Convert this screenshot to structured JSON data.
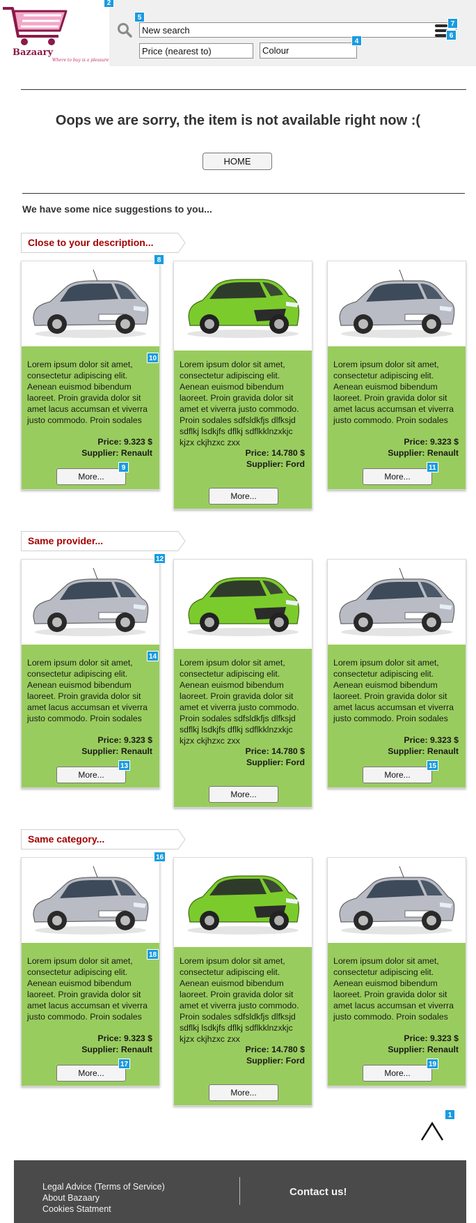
{
  "logo": {
    "name": "Bazaary",
    "tagline": "Where to buy is a pleasure"
  },
  "search": {
    "value": "New search",
    "price_value": "Price (nearest to)",
    "colour_value": "Colour"
  },
  "main": {
    "sorry": "Oops we are sorry, the item is not available right now :(",
    "home_label": "HOME",
    "suggestions": "We have some nice suggestions to you..."
  },
  "sections": [
    {
      "title": "Close to your description...",
      "cards": [
        {
          "car": "silver-hatchback",
          "desc": "Lorem ipsum dolor sit amet, consectetur adipiscing elit. Aenean euismod bibendum laoreet. Proin gravida dolor sit amet lacus accumsan et viverra justo commodo. Proin sodales",
          "price": "Price: 9.323 $",
          "supplier": "Supplier: Renault",
          "more": "More..."
        },
        {
          "car": "green-hatchback",
          "desc": "Lorem ipsum dolor sit amet, consectetur adipiscing elit. Aenean euismod bibendum laoreet. Proin gravida dolor sit amet et viverra justo commodo. Proin sodales sdfsldkfjs dlfksjd sdflkj lsdkjfs dflkj sdflkklnzxkjc kjzx ckjhzxc zxx",
          "price": "Price: 14.780 $",
          "supplier": "Supplier: Ford",
          "more": "More..."
        },
        {
          "car": "silver-hatchback",
          "desc": "Lorem ipsum dolor sit amet, consectetur adipiscing elit. Aenean euismod bibendum laoreet. Proin gravida dolor sit amet lacus accumsan et viverra justo commodo. Proin sodales",
          "price": "Price: 9.323 $",
          "supplier": "Supplier: Renault",
          "more": "More..."
        }
      ]
    },
    {
      "title": "Same provider...",
      "cards": [
        {
          "car": "silver-hatchback",
          "desc": "Lorem ipsum dolor sit amet, consectetur adipiscing elit. Aenean euismod bibendum laoreet. Proin gravida dolor sit amet lacus accumsan et viverra justo commodo. Proin sodales",
          "price": "Price: 9.323 $",
          "supplier": "Supplier: Renault",
          "more": "More..."
        },
        {
          "car": "green-hatchback",
          "desc": "Lorem ipsum dolor sit amet, consectetur adipiscing elit. Aenean euismod bibendum laoreet. Proin gravida dolor sit amet et viverra justo commodo. Proin sodales sdfsldkfjs dlfksjd sdflkj lsdkjfs dflkj sdflkklnzxkjc kjzx ckjhzxc zxx",
          "price": "Price: 14.780 $",
          "supplier": "Supplier: Ford",
          "more": "More..."
        },
        {
          "car": "silver-hatchback",
          "desc": "Lorem ipsum dolor sit amet, consectetur adipiscing elit. Aenean euismod bibendum laoreet. Proin gravida dolor sit amet lacus accumsan et viverra justo commodo. Proin sodales",
          "price": "Price: 9.323 $",
          "supplier": "Supplier: Renault",
          "more": "More..."
        }
      ]
    },
    {
      "title": "Same category...",
      "cards": [
        {
          "car": "silver-hatchback",
          "desc": "Lorem ipsum dolor sit amet, consectetur adipiscing elit. Aenean euismod bibendum laoreet. Proin gravida dolor sit amet lacus accumsan et viverra justo commodo. Proin sodales",
          "price": "Price: 9.323 $",
          "supplier": "Supplier: Renault",
          "more": "More..."
        },
        {
          "car": "green-hatchback",
          "desc": "Lorem ipsum dolor sit amet, consectetur adipiscing elit. Aenean euismod bibendum laoreet. Proin gravida dolor sit amet et viverra justo commodo. Proin sodales sdfsldkfjs dlfksjd sdflkj lsdkjfs dflkj sdflkklnzxkjc kjzx ckjhzxc zxx",
          "price": "Price: 14.780 $",
          "supplier": "Supplier: Ford",
          "more": "More..."
        },
        {
          "car": "silver-hatchback",
          "desc": "Lorem ipsum dolor sit amet, consectetur adipiscing elit. Aenean euismod bibendum laoreet. Proin gravida dolor sit amet lacus accumsan et viverra justo commodo. Proin sodales",
          "price": "Price: 9.323 $",
          "supplier": "Supplier: Renault",
          "more": "More..."
        }
      ]
    }
  ],
  "badges": [
    "1",
    "2",
    "4",
    "5",
    "6",
    "7",
    "8",
    "9",
    "10",
    "11",
    "12",
    "13",
    "14",
    "15",
    "16",
    "17",
    "18",
    "19"
  ],
  "footer": {
    "links": [
      "Legal Advice (Terms of Service)",
      "About Bazaary",
      "Cookies Statment"
    ],
    "contact": "Contact us!"
  },
  "colors": {
    "card_green": "#99cc5e",
    "badge_blue": "#1a9be0",
    "section_red": "#a40000",
    "footer_bg": "#4a4a4a",
    "logo_pink": "#e06fa0"
  }
}
